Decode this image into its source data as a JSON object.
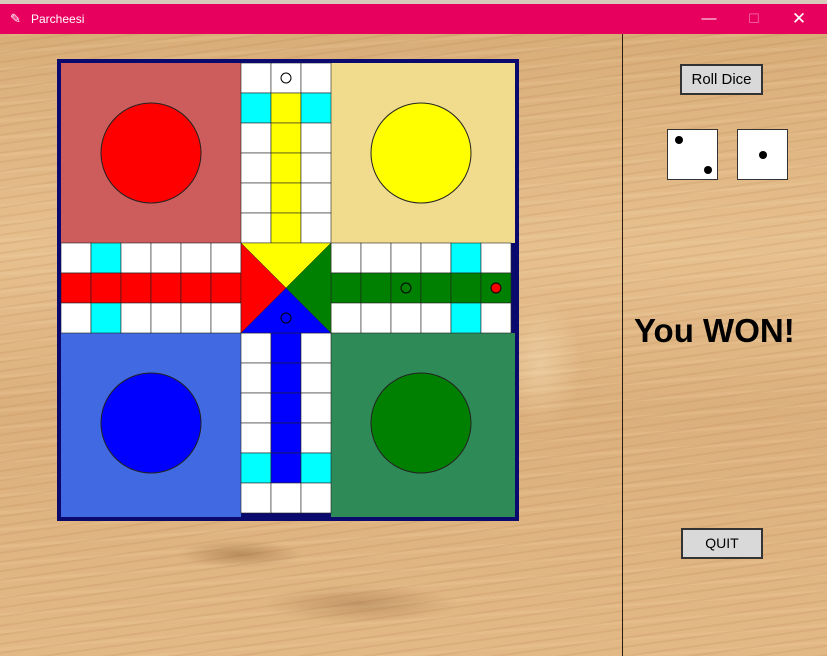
{
  "window": {
    "title": "Parcheesi",
    "minimize_glyph": "—",
    "maximize_glyph": "☐",
    "close_glyph": "✕",
    "icon": "feather-icon"
  },
  "controls": {
    "roll_label": "Roll Dice",
    "quit_label": "QUIT"
  },
  "dice": [
    2,
    1
  ],
  "status": "You WON!",
  "board": {
    "colors": {
      "red_home": "#cd5c5c",
      "red": "#ff0000",
      "yellow_home": "#f0dc8c",
      "yellow": "#ffff00",
      "blue_home": "#4169e1",
      "blue": "#0000ff",
      "green_home": "#2e8b57",
      "green": "#008000",
      "safe": "#00ffff",
      "frame": "#0a0a6e"
    },
    "tokens": [
      {
        "location": "yellow-path-top",
        "color": "#ffffff"
      },
      {
        "location": "green-lane",
        "color": "#008000"
      },
      {
        "location": "green-lane-end",
        "color": "#ff0000"
      },
      {
        "location": "blue-center",
        "color": "#0000ff"
      }
    ]
  }
}
